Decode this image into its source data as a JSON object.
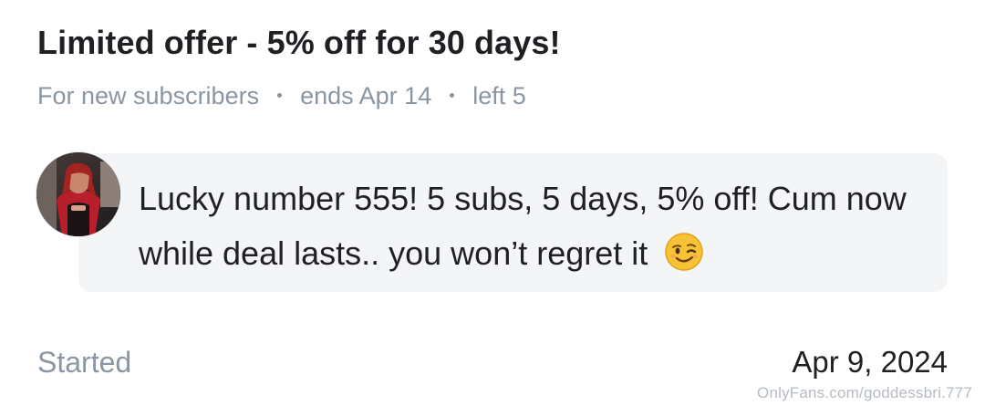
{
  "offer": {
    "title": "Limited offer - 5% off for 30 days!",
    "meta": [
      "For new subscribers",
      "ends Apr 14",
      "left 5"
    ]
  },
  "message": {
    "text": "Lucky number 555! 5 subs, 5 days, 5% off! Cum now while deal lasts.. you won’t regret it",
    "emoji": "winking-face"
  },
  "started": {
    "label": "Started",
    "date": "Apr 9, 2024"
  },
  "watermark": "OnlyFans.com/goddessbri.777",
  "colors": {
    "text": "#1f2023",
    "muted": "#8a96a3",
    "bubble": "#f4f5f7",
    "watermark": "#b6bcc4"
  }
}
